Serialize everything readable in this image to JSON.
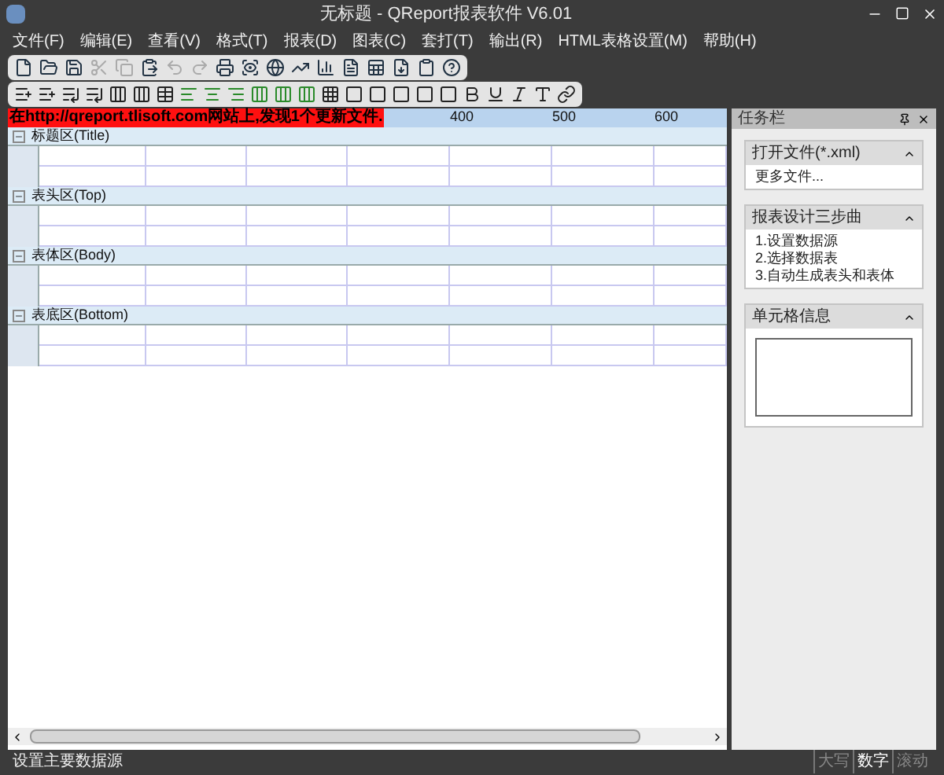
{
  "window": {
    "title": "无标题 - QReport报表软件 V6.01"
  },
  "menu": [
    "文件(F)",
    "编辑(E)",
    "查看(V)",
    "格式(T)",
    "报表(D)",
    "图表(C)",
    "套打(T)",
    "输出(R)",
    "HTML表格设置(M)",
    "帮助(H)"
  ],
  "toolbar_1": [
    {
      "disabled": false
    },
    {
      "disabled": false
    },
    {
      "disabled": false
    },
    {
      "disabled": true
    },
    {
      "disabled": true
    },
    {
      "disabled": false
    },
    {
      "disabled": true
    },
    {
      "disabled": true
    },
    {
      "disabled": false
    },
    {
      "disabled": false
    },
    {
      "disabled": false
    },
    {
      "disabled": false
    },
    {
      "disabled": false
    },
    {
      "disabled": false
    },
    {
      "disabled": false
    },
    {
      "disabled": false
    },
    {
      "disabled": false
    },
    {
      "disabled": false
    }
  ],
  "notice": "在http://qreport.tlisoft.com网站上,发现1个更新文件.",
  "ruler": [
    "400",
    "500",
    "600"
  ],
  "sections": [
    {
      "label": "标题区(Title)"
    },
    {
      "label": "表头区(Top)"
    },
    {
      "label": "表体区(Body)"
    },
    {
      "label": "表底区(Bottom)"
    }
  ],
  "task_pane": {
    "title": "任务栏",
    "panels": [
      {
        "title": "打开文件(*.xml)",
        "kind": "list",
        "items": [
          "更多文件..."
        ]
      },
      {
        "title": "报表设计三步曲",
        "kind": "list",
        "items": [
          "1.设置数据源",
          "2.选择数据表",
          "3.自动生成表头和表体"
        ]
      },
      {
        "title": "单元格信息",
        "kind": "box"
      }
    ]
  },
  "status_bar": {
    "message": "设置主要数据源",
    "indicators": [
      {
        "label": "大写",
        "on": false
      },
      {
        "label": "数字",
        "on": true
      },
      {
        "label": "滚动",
        "on": false
      }
    ]
  }
}
